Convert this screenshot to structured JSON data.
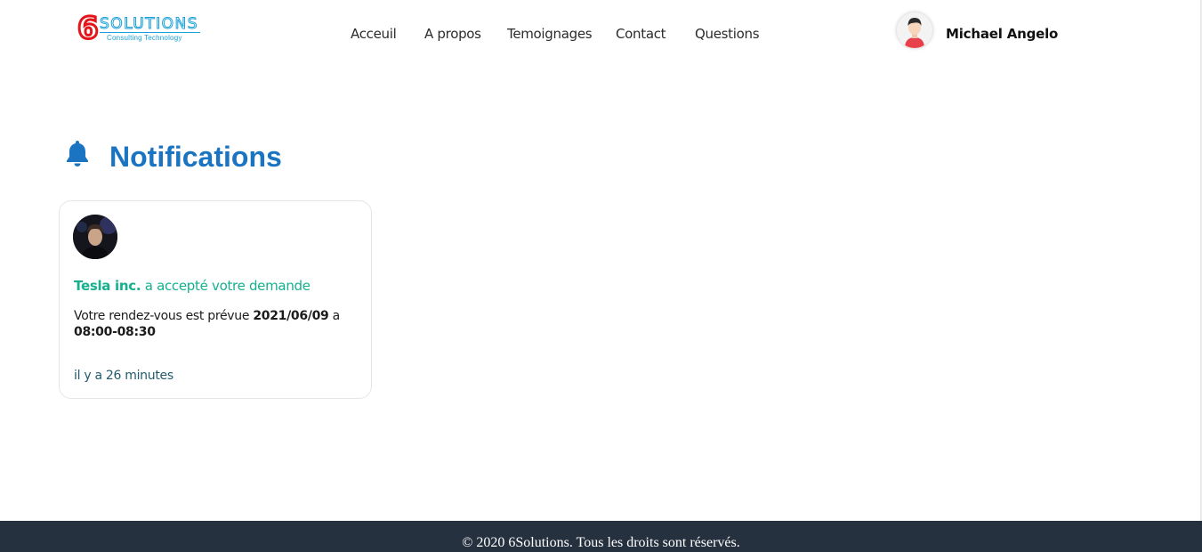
{
  "header": {
    "logo": {
      "digit": "6",
      "word": "SOLUTIONS",
      "tagline": "Consulting Technology"
    },
    "nav": [
      {
        "label": "Acceuil"
      },
      {
        "label": "A propos"
      },
      {
        "label": "Temoignages"
      },
      {
        "label": "Contact"
      },
      {
        "label": "Questions"
      }
    ],
    "user": {
      "name": "Michael Angelo"
    }
  },
  "main": {
    "title": "Notifications",
    "notification": {
      "company": "Tesla inc.",
      "action": " a accepté votre demande",
      "rdv_prefix": "Votre rendez-vous est prévue ",
      "date": "2021/06/09",
      "rdv_middle": " a ",
      "slot": "08:00-08:30",
      "time_ago": "il y a 26 minutes"
    }
  },
  "footer": {
    "text": "© 2020 6Solutions. Tous les droits sont réservés."
  },
  "colors": {
    "accent_blue": "#1a74c2",
    "accent_green": "#17b08e",
    "logo_red": "#e3161b",
    "logo_cyan": "#1aa0d8",
    "footer_bg": "#263140"
  }
}
